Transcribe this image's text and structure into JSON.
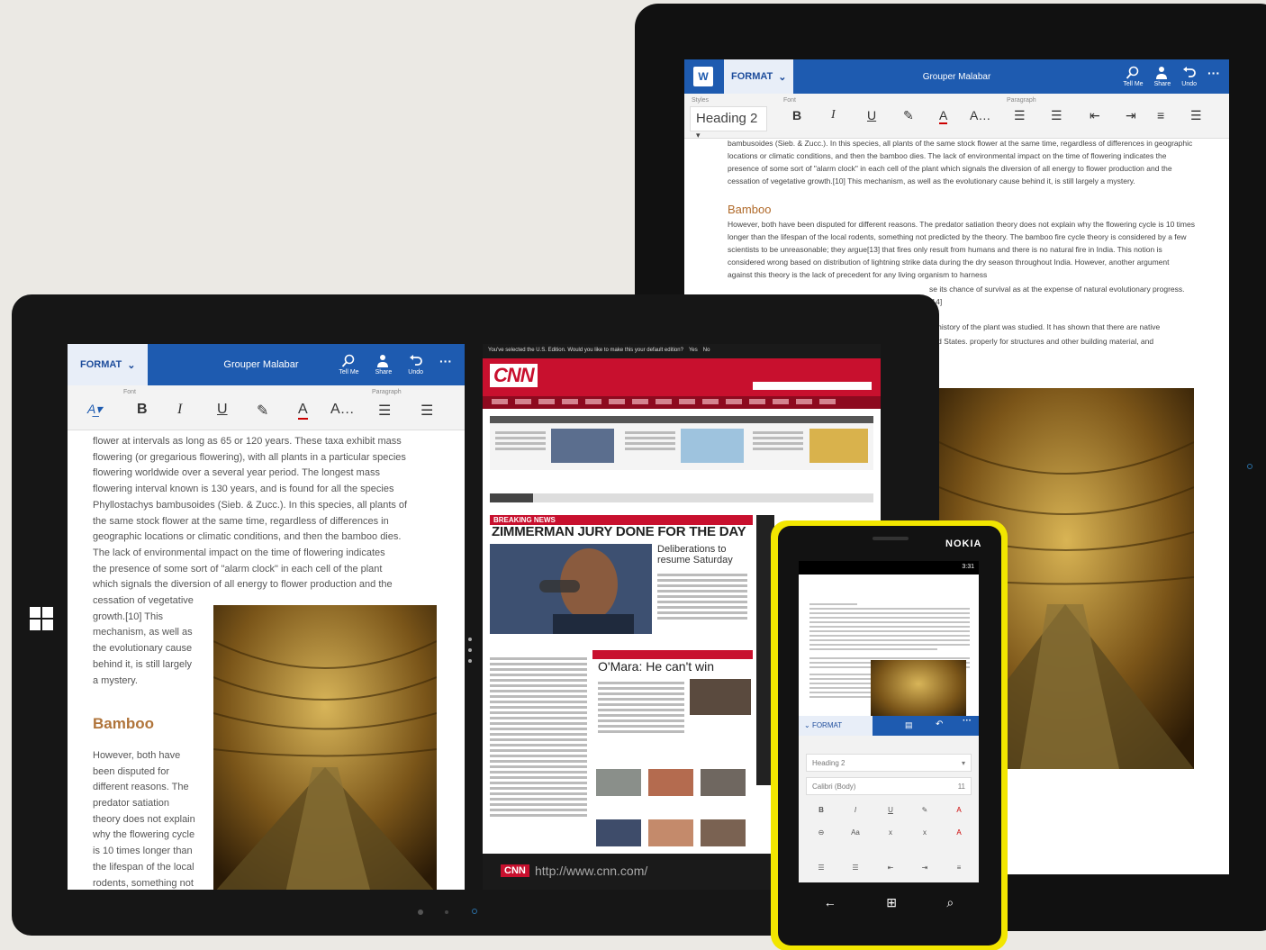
{
  "word_back": {
    "tab": "FORMAT",
    "title": "Grouper Malabar",
    "actions": [
      "Tell Me",
      "Share",
      "Undo"
    ],
    "ribbon": {
      "styles_label": "Styles",
      "font_label": "Font",
      "paragraph_label": "Paragraph",
      "style_value": "Heading 2"
    },
    "paragraph1": "bambusoides (Sieb. & Zucc.). In this species, all plants of the same stock flower at the same time, regardless of differences in geographic locations or climatic conditions, and then the bamboo dies. The lack of environmental impact on the time of flowering indicates the presence of some sort of \"alarm clock\" in each cell of the plant which signals the diversion of all energy to flower production and the cessation of vegetative growth.[10] This mechanism, as well as the evolutionary cause behind it, is still largely a mystery.",
    "heading": "Bamboo",
    "paragraph2": "However, both have been disputed for different reasons. The predator satiation theory does not explain why the flowering cycle is 10 times longer than the lifespan of the local rodents, something not predicted by the theory. The bamboo fire cycle theory is considered by a few scientists to be unreasonable; they argue[13] that fires only result from humans and there is no natural fire in India. This notion is considered wrong based on distribution of lightning strike data during the dry season throughout India. However, another argument against this theory is the lack of precedent for any living organism to harness",
    "paragraph3": "se its chance of survival as at the expense of natural evolutionary progress.[14]",
    "paragraph4": "e history of the plant was studied. It has shown that there are native",
    "paragraph5": "ted States. properly for structures and other building material, and"
  },
  "word_front": {
    "tab": "FORMAT",
    "title": "Grouper Malabar",
    "actions": [
      "Tell Me",
      "Share",
      "Undo"
    ],
    "ribbon": {
      "font_label": "Font",
      "paragraph_label": "Paragraph"
    },
    "p1_lines": [
      "flower at intervals as long as 65 or 120 years. These taxa exhibit mass",
      "flowering (or gregarious flowering), with all plants in a particular species",
      "flowering worldwide over a several year period. The longest mass",
      "flowering interval known is 130 years, and is found for all the species",
      "Phyllostachys bambusoides (Sieb. & Zucc.). In this species, all plants of",
      "the same stock flower at the same time, regardless of differences in",
      "geographic locations or climatic conditions, and then the bamboo dies.",
      "The lack of environmental impact on the time of flowering indicates",
      "the presence of some sort of \"alarm clock\" in each cell of the plant",
      "which signals the diversion of all energy to flower production and the"
    ],
    "p1_narrow": [
      "cessation of vegetative",
      "growth.[10] This",
      "mechanism, as well as",
      "the evolutionary cause",
      "behind it, is still largely",
      "a mystery."
    ],
    "heading": "Bamboo",
    "p2_narrow": [
      "However, both have",
      "been disputed for",
      "different reasons. The",
      "predator satiation",
      "theory does not explain",
      "why the flowering cycle",
      "is 10 times longer than",
      "the lifespan of the local",
      "rodents, something not"
    ]
  },
  "cnn": {
    "notice": "You've selected the U.S. Edition. Would you like to make this your default edition?",
    "notice_yes": "Yes",
    "notice_no": "No",
    "logo": "CNN",
    "breaking": "BREAKING NEWS",
    "headline": "ZIMMERMAN JURY DONE FOR THE DAY",
    "subhead": "Deliberations to resume Saturday",
    "omara": "O'Mara: He can't win",
    "url_badge": "CNN",
    "url": "http://www.cnn.com/"
  },
  "phone": {
    "brand": "NOKIA",
    "time": "3:31",
    "tab": "FORMAT",
    "style_value": "Heading 2",
    "font_value": "Calibri (Body)",
    "font_size": "11"
  }
}
